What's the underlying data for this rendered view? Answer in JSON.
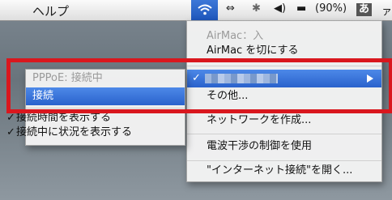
{
  "menubar": {
    "help": "ヘルプ",
    "battery": "(90%)",
    "input_indicator": "あ",
    "trailing": "ァ"
  },
  "airmac_menu": {
    "status": "AirMac：入",
    "toggle": "AirMac を切にする",
    "other": "その他...",
    "create_network": "ネットワークを作成...",
    "interference": "電波干渉の制御を使用",
    "open_internet_connect": "\"インターネット接続\"を開く..."
  },
  "sub_menu": {
    "pppoe_status": "PPPoE: 接続中",
    "connect": "接続",
    "show_time": "接続時間を表示する",
    "show_status": "接続中に状況を表示する"
  },
  "colors": {
    "highlight": "#2a62cc",
    "annotation_red": "#d9171e"
  }
}
